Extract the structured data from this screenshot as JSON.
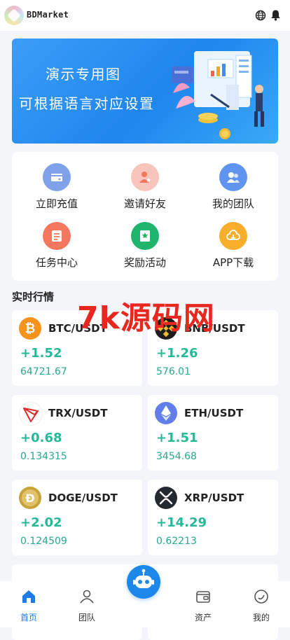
{
  "header": {
    "app_title": "BDMarket",
    "globe_icon": "globe-icon",
    "bell_icon": "bell-icon"
  },
  "banner": {
    "line1": "演示专用图",
    "line2": "可根据语言对应设置",
    "bg_color": "#2a90f0"
  },
  "menu": {
    "items": [
      {
        "label": "立即充值",
        "icon": "recharge-icon",
        "color": "#7ea1ea"
      },
      {
        "label": "邀请好友",
        "icon": "invite-friend-icon",
        "color": "#f7a89a"
      },
      {
        "label": "我的团队",
        "icon": "team-icon",
        "color": "#5f95ef"
      },
      {
        "label": "任务中心",
        "icon": "task-center-icon",
        "color": "#f4775f"
      },
      {
        "label": "奖励活动",
        "icon": "reward-activity-icon",
        "color": "#1fb56c"
      },
      {
        "label": "APP下载",
        "icon": "app-download-icon",
        "color": "#f8ad2b"
      }
    ]
  },
  "market": {
    "title": "实时行情",
    "coins": [
      {
        "pair": "BTC/USDT",
        "change": "+1.52",
        "price": "64721.67",
        "icon": "btc-icon",
        "color": "#f7931a"
      },
      {
        "pair": "BNB/USDT",
        "change": "+1.26",
        "price": "576.01",
        "icon": "bnb-icon",
        "color": "#1e1e1e"
      },
      {
        "pair": "TRX/USDT",
        "change": "+0.68",
        "price": "0.134315",
        "icon": "trx-icon",
        "color": "#e02d2d"
      },
      {
        "pair": "ETH/USDT",
        "change": "+1.51",
        "price": "3454.68",
        "icon": "eth-icon",
        "color": "#627eea"
      },
      {
        "pair": "DOGE/USDT",
        "change": "+2.02",
        "price": "0.124509",
        "icon": "doge-icon",
        "color": "#c8a33a"
      },
      {
        "pair": "XRP/USDT",
        "change": "+14.29",
        "price": "0.62213",
        "icon": "xrp-icon",
        "color": "#23292f"
      }
    ],
    "accent": "#25b99a"
  },
  "watermark": {
    "text": "7k源码网"
  },
  "tabbar": {
    "items": [
      {
        "label": "首页",
        "icon": "home-icon"
      },
      {
        "label": "团队",
        "icon": "team-tab-icon"
      },
      {
        "label": "资产",
        "icon": "wallet-icon"
      },
      {
        "label": "我的",
        "icon": "profile-icon"
      }
    ],
    "active_color": "#1f7be6",
    "center_icon": "robot-assistant-icon"
  }
}
